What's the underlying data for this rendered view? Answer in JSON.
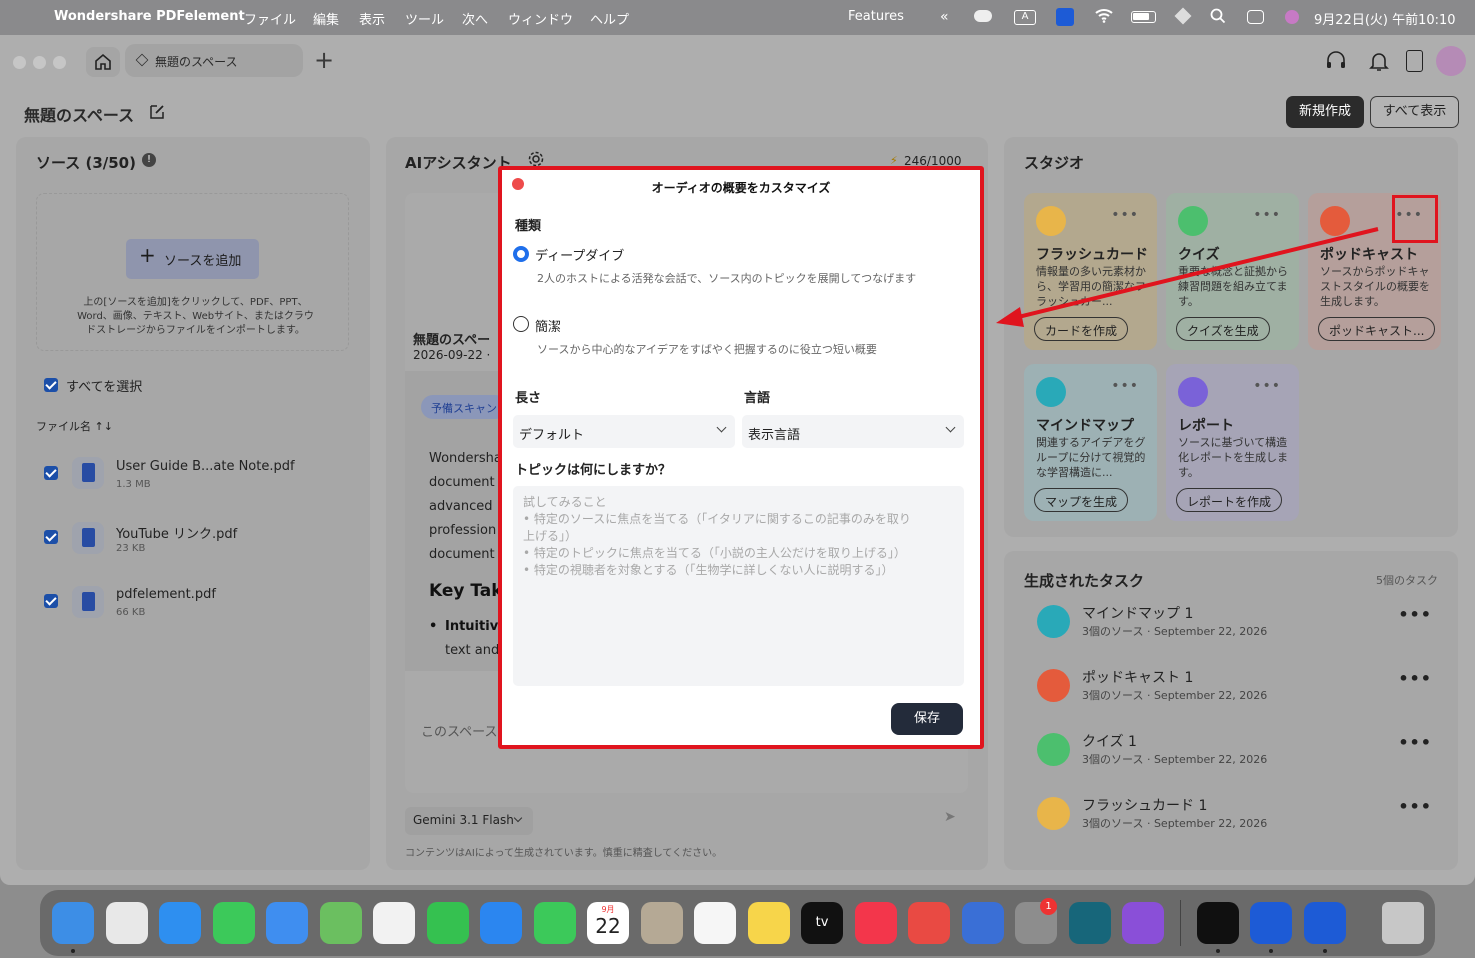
{
  "menubar": {
    "app_name": "Wondershare PDFelement",
    "menus": [
      "ファイル",
      "編集",
      "表示",
      "ツール",
      "次へ",
      "ウィンドウ",
      "ヘルプ"
    ],
    "features": "Features",
    "datetime": "9月22日(火) 午前10:10"
  },
  "toolbar": {
    "tab_label": "無題のスペース"
  },
  "header": {
    "title": "無題のスペース",
    "new_button": "新規作成",
    "show_all_button": "すべて表示"
  },
  "sources": {
    "title": "ソース (3/50)",
    "add_button": "ソースを追加",
    "hint": "上の[ソースを追加]をクリックして、PDF、PPT、Word、画像、テキスト、Webサイト、またはクラウドストレージからファイルをインポートします。",
    "select_all": "すべてを選択",
    "sort_label": "ファイル名 ↑↓",
    "files": [
      {
        "name": "User Guide B...ate Note.pdf",
        "size": "1.3 MB"
      },
      {
        "name": "YouTube リンク.pdf",
        "size": "23 KB"
      },
      {
        "name": "pdfelement.pdf",
        "size": "66 KB"
      }
    ]
  },
  "assistant": {
    "title": "AIアシスタント",
    "quota": "246/1000",
    "doc_title": "無題のスペー",
    "doc_date": "2026-09-22 ·",
    "tag": "予備スキャン",
    "body_lines": [
      "Wondersha",
      "document",
      "advanced",
      "profession",
      "document"
    ],
    "key_heading": "Key Tak",
    "bullet": "Intuitive",
    "bullet_line2": "text and",
    "placeholder_partial": "このスペース",
    "model": "Gemini 3.1 Flash",
    "disclaimer": "コンテンツはAIによって生成されています。慎重に精査してください。"
  },
  "studio": {
    "title": "スタジオ",
    "cards": [
      {
        "title": "フラッシュカード",
        "desc": "情報量の多い元素材から、学習用の簡潔なフラッシュカー...",
        "button": "カードを作成",
        "color": "#e8b54a"
      },
      {
        "title": "クイズ",
        "desc": "重要な概念と証拠から練習問題を組み立てます。",
        "button": "クイズを生成",
        "color": "#4cbf6e"
      },
      {
        "title": "ポッドキャスト",
        "desc": "ソースからポッドキャストスタイルの概要を生成します。",
        "button": "ポッドキャスト...",
        "color": "#e45b3c"
      },
      {
        "title": "マインドマップ",
        "desc": "関連するアイデアをグループに分けて視覚的な学習構造に...",
        "button": "マップを生成",
        "color": "#29a9b8"
      },
      {
        "title": "レポート",
        "desc": "ソースに基づいて構造化レポートを生成します。",
        "button": "レポートを作成",
        "color": "#7a62d8"
      }
    ],
    "tasks_title": "生成されたタスク",
    "tasks_count": "5個のタスク",
    "tasks": [
      {
        "name": "マインドマップ 1",
        "meta": "3個のソース · September 22, 2026",
        "color": "#29a9b8"
      },
      {
        "name": "ポッドキャスト 1",
        "meta": "3個のソース · September 22, 2026",
        "color": "#e45b3c"
      },
      {
        "name": "クイズ 1",
        "meta": "3個のソース · September 22, 2026",
        "color": "#4cbf6e"
      },
      {
        "name": "フラッシュカード 1",
        "meta": "3個のソース · September 22, 2026",
        "color": "#e8b54a"
      }
    ]
  },
  "modal": {
    "title": "オーディオの概要をカスタマイズ",
    "type_label": "種類",
    "options": [
      {
        "label": "ディープダイブ",
        "desc": "2人のホストによる活発な会話で、ソース内のトピックを展開してつなげます",
        "selected": true
      },
      {
        "label": "簡潔",
        "desc": "ソースから中心的なアイデアをすばやく把握するのに役立つ短い概要",
        "selected": false
      }
    ],
    "length_label": "長さ",
    "length_value": "デフォルト",
    "language_label": "言語",
    "language_value": "表示言語",
    "topic_label": "トピックは何にしますか？",
    "topic_placeholder_lines": [
      "試してみること",
      "• 特定のソースに焦点を当てる（「イタリアに関するこの記事のみを取り",
      "上げる」）",
      "• 特定のトピックに焦点を当てる（「小説の主人公だけを取り上げる」）",
      "• 特定の視聴者を対象とする（「生物学に詳しくない人に説明する」）"
    ],
    "save_button": "保存"
  },
  "dock": {
    "calendar_day": "22",
    "calendar_month": "9月",
    "tv_label": "tv",
    "badge": "1"
  },
  "colors": {
    "accent_red": "#e0141e",
    "radio_blue": "#1f6feb",
    "dark_button": "#2b2b2b"
  }
}
